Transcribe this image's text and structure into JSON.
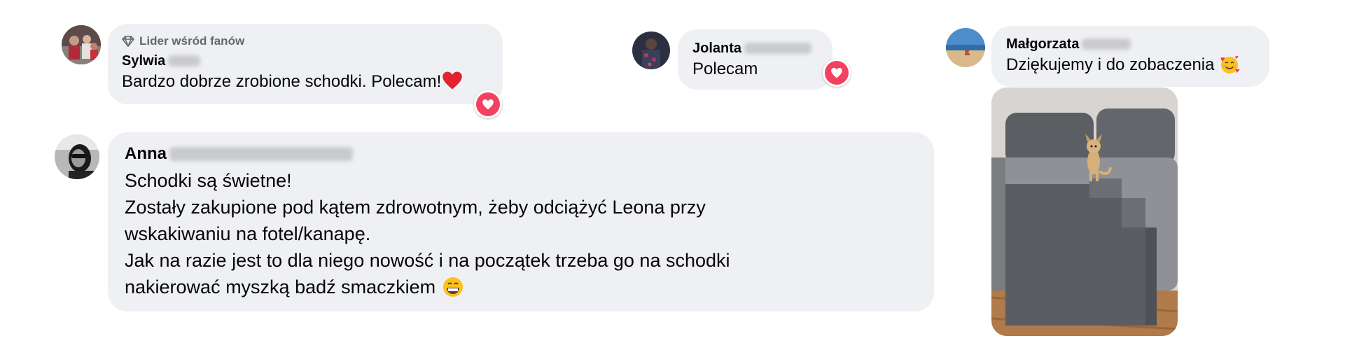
{
  "comments": [
    {
      "badge": "Lider wśród fanów",
      "author_first": "Sylwia",
      "text": "Bardzo dobrze zrobione schodki. Polecam!",
      "inline_emoji": "heart",
      "reaction": "love"
    },
    {
      "author_first": "Jolanta",
      "text": "Polecam",
      "reaction": "love"
    },
    {
      "author_first": "Małgorzata",
      "text": "Dziękujemy i do zobaczenia",
      "inline_emoji": "smiling-face-with-hearts",
      "attachment": "photo of a chihuahua dog sitting on grey pet steps beside a sofa"
    },
    {
      "author_first": "Anna",
      "text_lines": [
        "Schodki są świetne!",
        "Zostały zakupione pod kątem zdrowotnym, żeby odciążyć Leona przy",
        "wskakiwaniu na fotel/kanapę.",
        "Jak na razie jest to dla niego nowość i na początek trzeba go na schodki",
        "nakierować myszką badź smaczkiem"
      ],
      "inline_emoji": "grinning-face"
    }
  ],
  "colors": {
    "bubble_bg": "#eff0f3",
    "love_reaction": "#f3425f",
    "badge_text": "#65676b"
  }
}
